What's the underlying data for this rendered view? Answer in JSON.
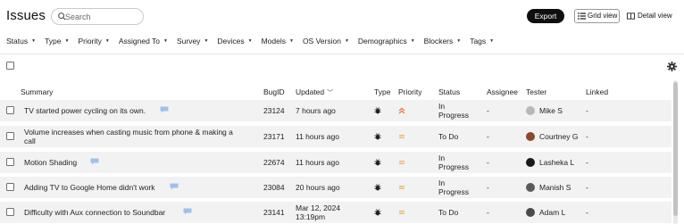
{
  "header": {
    "title": "Issues",
    "search_placeholder": "Search",
    "export_label": "Export",
    "grid_view_label": "Grid view",
    "detail_view_label": "Detail view"
  },
  "filters": [
    "Status",
    "Type",
    "Priority",
    "Assigned To",
    "Survey",
    "Devices",
    "Models",
    "OS Version",
    "Demographics",
    "Blockers",
    "Tags"
  ],
  "columns": {
    "summary": "Summary",
    "bug_id": "BugID",
    "updated": "Updated",
    "type": "Type",
    "priority": "Priority",
    "status": "Status",
    "assignee": "Assignee",
    "tester": "Tester",
    "linked": "Linked"
  },
  "rows": [
    {
      "summary_line1": "TV started power cycling on its own.",
      "summary_line2": "",
      "bug_id": "23124",
      "updated_line1": "7 hours ago",
      "updated_line2": "",
      "type_icon": "bug-icon",
      "priority": "high",
      "status_line1": "In",
      "status_line2": "Progress",
      "assignee": "-",
      "tester": "Mike S",
      "linked": "-",
      "avatar_color": "#b8b8b8"
    },
    {
      "summary_line1": "Volume increases when casting music from phone & making a",
      "summary_line2": "call",
      "bug_id": "23171",
      "updated_line1": "11 hours ago",
      "updated_line2": "",
      "type_icon": "bug-icon",
      "priority": "medium",
      "status_line1": "To Do",
      "status_line2": "",
      "assignee": "-",
      "tester": "Courtney G",
      "linked": "-",
      "avatar_color": "#8a4a2a"
    },
    {
      "summary_line1": "Motion Shading",
      "summary_line2": "",
      "bug_id": "22674",
      "updated_line1": "11 hours ago",
      "updated_line2": "",
      "type_icon": "bug-icon",
      "priority": "medium",
      "status_line1": "In",
      "status_line2": "Progress",
      "assignee": "-",
      "tester": "Lasheka L",
      "linked": "-",
      "avatar_color": "#1a1a1a"
    },
    {
      "summary_line1": "Adding TV to Google Home didn't work",
      "summary_line2": "",
      "bug_id": "23084",
      "updated_line1": "20 hours ago",
      "updated_line2": "",
      "type_icon": "bug-icon",
      "priority": "medium",
      "status_line1": "In",
      "status_line2": "Progress",
      "assignee": "-",
      "tester": "Manish S",
      "linked": "-",
      "avatar_color": "#5b5b5b"
    },
    {
      "summary_line1": "Difficulty with Aux connection to Soundbar",
      "summary_line2": "",
      "bug_id": "23141",
      "updated_line1": "Mar 12, 2024",
      "updated_line2": "13:19pm",
      "type_icon": "bug-icon",
      "priority": "medium",
      "status_line1": "To Do",
      "status_line2": "",
      "assignee": "-",
      "tester": "Adam L",
      "linked": "-",
      "avatar_color": "#4a4a4a"
    }
  ],
  "colors": {
    "row_background": "#f2f2f2",
    "priority_high": "#f06a2a",
    "priority_medium": "#f3a34a",
    "comment_icon": "#9fc1ea",
    "button_dark": "#0f0f0f"
  }
}
